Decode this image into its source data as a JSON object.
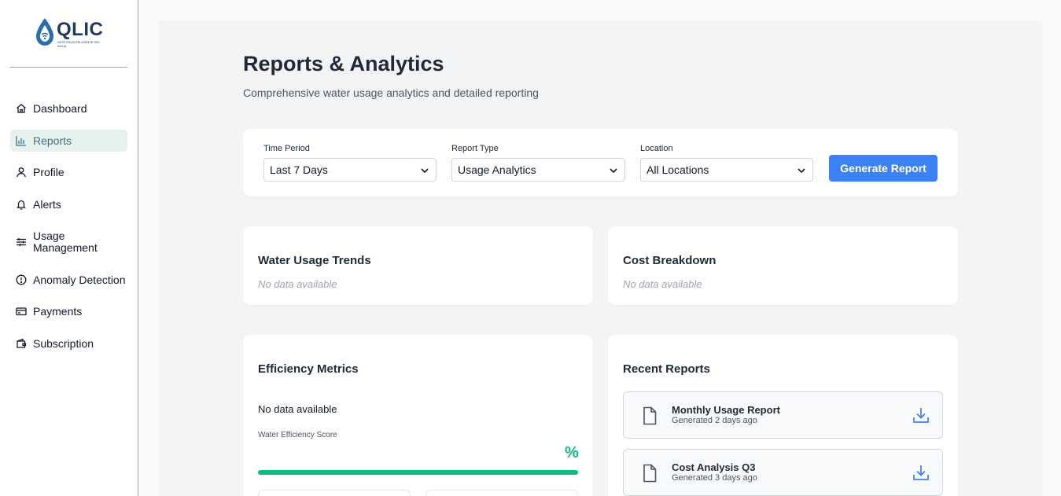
{
  "brand": {
    "name": "QLIC",
    "tagline": "GESTIÓN INTELIGENTE DEL AGUA"
  },
  "sidebar": {
    "items": [
      {
        "label": "Dashboard",
        "icon": "home-icon"
      },
      {
        "label": "Reports",
        "icon": "bar-chart-icon",
        "active": true
      },
      {
        "label": "Profile",
        "icon": "user-icon"
      },
      {
        "label": "Alerts",
        "icon": "bell-icon"
      },
      {
        "label": "Usage Management",
        "icon": "sliders-icon"
      },
      {
        "label": "Anomaly Detection",
        "icon": "alert-circle-icon"
      },
      {
        "label": "Payments",
        "icon": "credit-card-icon"
      },
      {
        "label": "Subscription",
        "icon": "wallet-icon"
      }
    ]
  },
  "header": {
    "title": "Reports & Analytics",
    "subtitle": "Comprehensive water usage analytics and detailed reporting"
  },
  "filters": {
    "time_period": {
      "label": "Time Period",
      "value": "Last 7 Days"
    },
    "report_type": {
      "label": "Report Type",
      "value": "Usage Analytics"
    },
    "location": {
      "label": "Location",
      "value": "All Locations"
    },
    "generate_label": "Generate Report"
  },
  "usage_trends": {
    "title": "Water Usage Trends",
    "empty": "No data available"
  },
  "cost_breakdown": {
    "title": "Cost Breakdown",
    "empty": "No data available"
  },
  "efficiency": {
    "title": "Efficiency Metrics",
    "empty": "No data available",
    "score_label": "Water Efficiency Score",
    "score_value": "%",
    "progress": 1.0
  },
  "recent_reports": {
    "title": "Recent Reports",
    "items": [
      {
        "name": "Monthly Usage Report",
        "meta": "Generated 2 days ago"
      },
      {
        "name": "Cost Analysis Q3",
        "meta": "Generated 3 days ago"
      }
    ]
  },
  "colors": {
    "accent": "#3b82f6",
    "success": "#10b981",
    "active_nav_bg": "#e6f2ee",
    "active_nav_text": "#3b7289"
  }
}
